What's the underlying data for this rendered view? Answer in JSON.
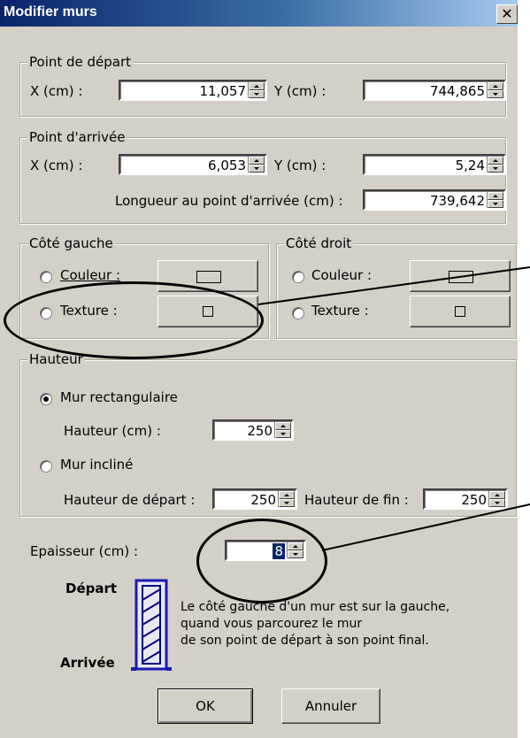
{
  "window": {
    "title": "Modifier murs",
    "close_symbol": "✕"
  },
  "start_point": {
    "legend": "Point de départ",
    "x_label": "X (cm) :",
    "x_value": "11,057",
    "y_label": "Y (cm) :",
    "y_value": "744,865"
  },
  "end_point": {
    "legend": "Point d'arrivée",
    "x_label": "X (cm) :",
    "x_value": "6,053",
    "y_label": "Y (cm) :",
    "y_value": "5,24",
    "length_label": "Longueur au point d'arrivée (cm) :",
    "length_value": "739,642"
  },
  "left_side": {
    "legend": "Côté gauche",
    "color_label": "Couleur :",
    "texture_label": "Texture :"
  },
  "right_side": {
    "legend": "Côté droit",
    "color_label": "Couleur :",
    "texture_label": "Texture :"
  },
  "height": {
    "legend": "Hauteur",
    "rect_label": "Mur rectangulaire",
    "rect_height_label": "Hauteur (cm) :",
    "rect_height_value": "250",
    "inclined_label": "Mur incliné",
    "start_height_label": "Hauteur de départ :",
    "start_height_value": "250",
    "end_height_label": "Hauteur de fin :",
    "end_height_value": "250"
  },
  "thickness": {
    "label": "Epaisseur (cm) :",
    "value": "8"
  },
  "diagram": {
    "start_label": "Départ",
    "end_label": "Arrivée",
    "help_line1": "Le côté gauche d'un mur est sur la gauche,",
    "help_line2": "quand vous parcourez le mur",
    "help_line3": "de son point de départ à son point final."
  },
  "buttons": {
    "ok": "OK",
    "cancel": "Annuler"
  },
  "colors": {
    "dialog_bg": "#d4d0c8",
    "title_bg": "#0a246a",
    "annotation": "#000000"
  }
}
